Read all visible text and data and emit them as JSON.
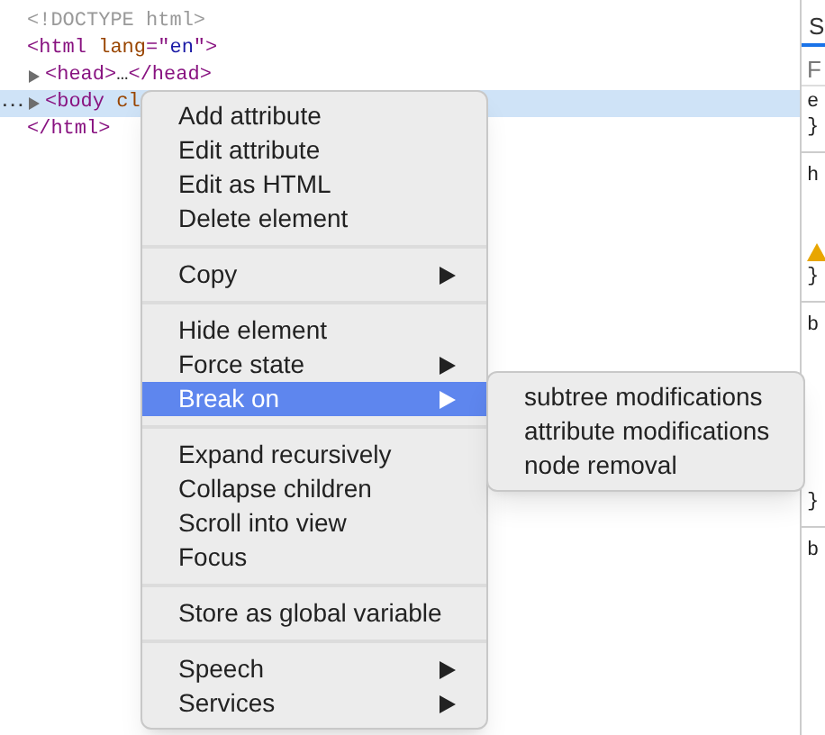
{
  "tree": [
    {
      "expandable": false,
      "selected": false,
      "segments": [
        {
          "kind": "doctype",
          "text": "<!DOCTYPE html>"
        }
      ]
    },
    {
      "expandable": false,
      "selected": false,
      "segments": [
        {
          "kind": "tag",
          "text": "<html "
        },
        {
          "kind": "attr",
          "text": "lang"
        },
        {
          "kind": "tag",
          "text": "=\""
        },
        {
          "kind": "value",
          "text": "en"
        },
        {
          "kind": "tag",
          "text": "\">"
        }
      ]
    },
    {
      "expandable": true,
      "selected": false,
      "segments": [
        {
          "kind": "tag",
          "text": "<head>"
        },
        {
          "kind": "plain",
          "text": "…"
        },
        {
          "kind": "tag",
          "text": "</head>"
        }
      ]
    },
    {
      "expandable": true,
      "selected": true,
      "gutter": "...",
      "segments": [
        {
          "kind": "tag",
          "text": "<body "
        },
        {
          "kind": "attr",
          "text": "cl"
        }
      ]
    },
    {
      "expandable": false,
      "selected": false,
      "segments": [
        {
          "kind": "tag",
          "text": "</html>"
        }
      ]
    }
  ],
  "styles_pane": {
    "tab": "S",
    "selected": true,
    "filter_placeholder": "F",
    "lines": [
      {
        "kind": "code",
        "text": "e"
      },
      {
        "kind": "code",
        "text": "}"
      },
      {
        "kind": "rule"
      },
      {
        "kind": "code",
        "text": "h"
      },
      {
        "kind": "gap"
      },
      {
        "kind": "warning"
      },
      {
        "kind": "code",
        "text": "}"
      },
      {
        "kind": "rule"
      },
      {
        "kind": "code",
        "text": "b"
      },
      {
        "kind": "gap"
      },
      {
        "kind": "gap"
      },
      {
        "kind": "gap"
      },
      {
        "kind": "code",
        "text": "}"
      },
      {
        "kind": "rule"
      },
      {
        "kind": "code",
        "text": "b"
      }
    ]
  },
  "context_menu": {
    "groups": [
      [
        {
          "label": "Add attribute",
          "submenu": false,
          "selected": false
        },
        {
          "label": "Edit attribute",
          "submenu": false,
          "selected": false
        },
        {
          "label": "Edit as HTML",
          "submenu": false,
          "selected": false
        },
        {
          "label": "Delete element",
          "submenu": false,
          "selected": false
        }
      ],
      [
        {
          "label": "Copy",
          "submenu": true,
          "selected": false
        }
      ],
      [
        {
          "label": "Hide element",
          "submenu": false,
          "selected": false
        },
        {
          "label": "Force state",
          "submenu": true,
          "selected": false
        },
        {
          "label": "Break on",
          "submenu": true,
          "selected": true
        }
      ],
      [
        {
          "label": "Expand recursively",
          "submenu": false,
          "selected": false
        },
        {
          "label": "Collapse children",
          "submenu": false,
          "selected": false
        },
        {
          "label": "Scroll into view",
          "submenu": false,
          "selected": false
        },
        {
          "label": "Focus",
          "submenu": false,
          "selected": false
        }
      ],
      [
        {
          "label": "Store as global variable",
          "submenu": false,
          "selected": false
        }
      ],
      [
        {
          "label": "Speech",
          "submenu": true,
          "selected": false
        },
        {
          "label": "Services",
          "submenu": true,
          "selected": false
        }
      ]
    ]
  },
  "submenu": {
    "items": [
      {
        "label": "subtree modifications"
      },
      {
        "label": "attribute modifications"
      },
      {
        "label": "node removal"
      }
    ]
  }
}
